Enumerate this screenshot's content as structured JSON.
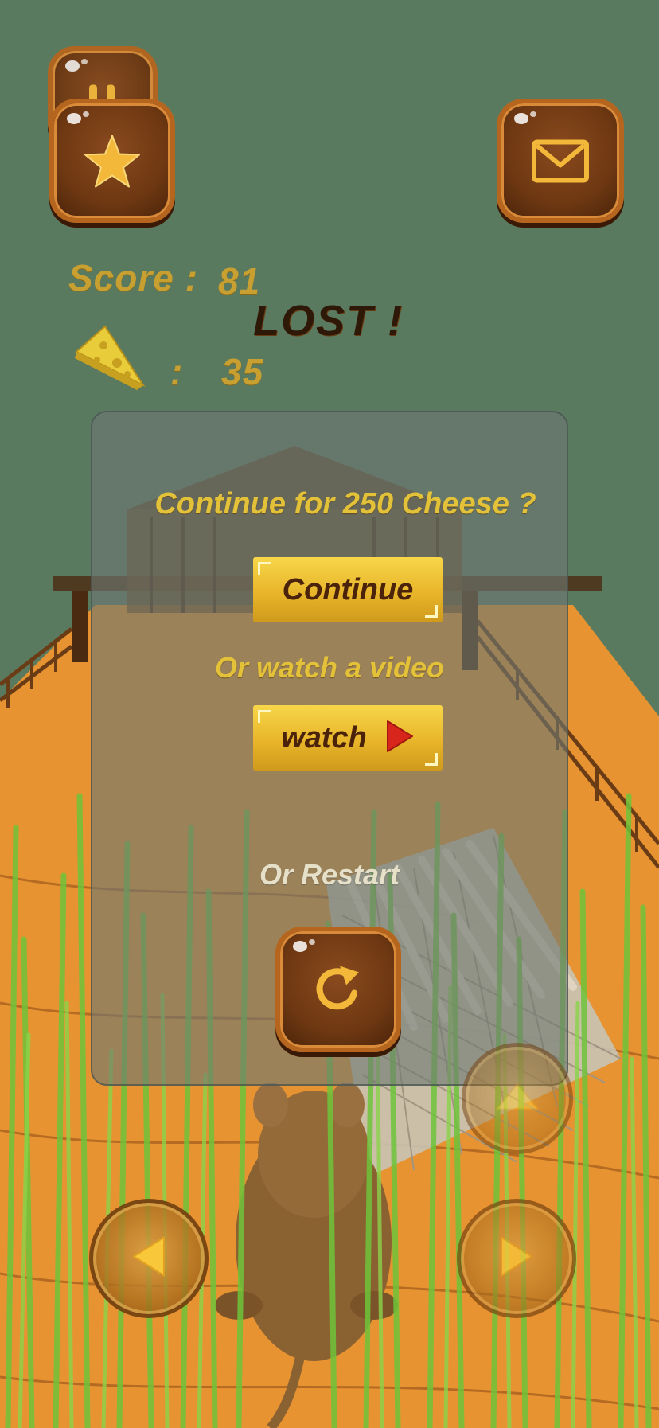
{
  "hud": {
    "score_label": "Score :",
    "score_value": "81",
    "cheese_colon": ":",
    "cheese_value": "35",
    "status": "LOST !"
  },
  "top_buttons": {
    "left": "star-icon",
    "right": "mail-icon",
    "behind": "pause-icon"
  },
  "dialog": {
    "continue_question": "Continue for 250 Cheese ?",
    "continue_label": "Continue",
    "watch_question": "Or watch a video",
    "watch_label": "watch",
    "restart_question": "Or Restart",
    "restart_icon": "restart-icon"
  },
  "controls": {
    "left": "left-arrow-icon",
    "right": "right-arrow-icon",
    "jump": "up-arrow-icon"
  },
  "colors": {
    "sky": "#5a7a60",
    "ground": "#e8922e",
    "gold_text": "#c8a032",
    "lost_text": "#2e1808",
    "wood": "#6e3812",
    "button_gold": "#f2cb3e",
    "play_red": "#d8261c"
  }
}
